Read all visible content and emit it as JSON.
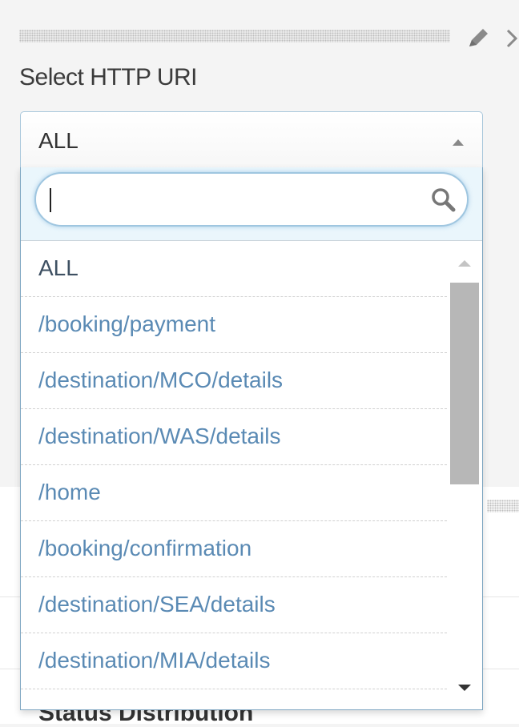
{
  "panel": {
    "label": "Select HTTP URI"
  },
  "select": {
    "value": "ALL",
    "search_value": ""
  },
  "options": [
    "ALL",
    "/booking/payment",
    "/destination/MCO/details",
    "/destination/WAS/details",
    "/home",
    "/booking/confirmation",
    "/destination/SEA/details",
    "/destination/MIA/details"
  ],
  "background_panel": {
    "title": "Status Distribution"
  },
  "icons": {
    "edit": "pencil-icon",
    "collapse": "chevron-right-icon",
    "search": "search-icon"
  },
  "colors": {
    "option_link": "#5a8ab4",
    "option_active": "#3e5062",
    "search_bg": "#eaf6fc",
    "focus_border": "#9fc6e0"
  }
}
